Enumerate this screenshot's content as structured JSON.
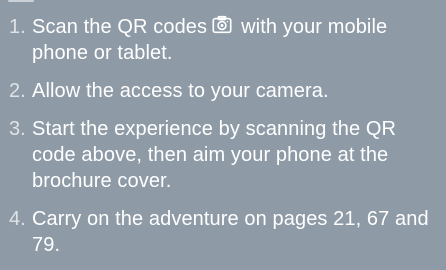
{
  "instructions": [
    {
      "number": "1.",
      "text_before_icon": "Scan the QR codes",
      "icon": "camera-icon",
      "text_after_icon": "with your mobile phone or tablet."
    },
    {
      "number": "2.",
      "text": "Allow the access to your camera."
    },
    {
      "number": "3.",
      "text": "Start the experience by scanning the QR code above, then aim your phone at the brochure cover."
    },
    {
      "number": "4.",
      "text": "Carry on the adventure on pages 21, 67 and 79."
    }
  ],
  "colors": {
    "background": "#8e9aa6",
    "text": "#ffffff",
    "number": "rgba(255,255,255,0.72)"
  }
}
